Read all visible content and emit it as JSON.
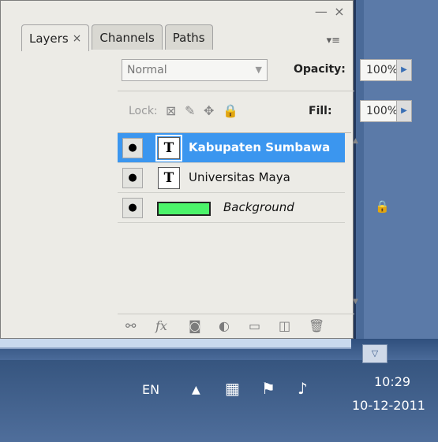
{
  "tabs": [
    {
      "label": "Layers",
      "close": "×"
    },
    {
      "label": "Channels"
    },
    {
      "label": "Paths"
    }
  ],
  "window_controls": {
    "minimize": "—",
    "close": "×",
    "menu": "▾≡"
  },
  "blend_mode": "Normal",
  "opacity": {
    "label": "Opacity:",
    "value": "100%"
  },
  "lock": {
    "label": "Lock:"
  },
  "fill": {
    "label": "Fill:",
    "value": "100%"
  },
  "layers": [
    {
      "name": "Kabupaten Sumbawa",
      "type": "text",
      "selected": true,
      "thumb": "T"
    },
    {
      "name": "Universitas Maya",
      "type": "text",
      "selected": false,
      "thumb": "T"
    },
    {
      "name": "Background",
      "type": "image",
      "selected": false,
      "locked": true,
      "thumb_color": "#4cf36a"
    }
  ],
  "tray": {
    "language": "EN",
    "time": "10:29",
    "date": "10-12-2011"
  },
  "colors": {
    "selected": "#3b96ef",
    "panel_bg": "#ecebe6",
    "taskbar": "#4d6b99"
  }
}
